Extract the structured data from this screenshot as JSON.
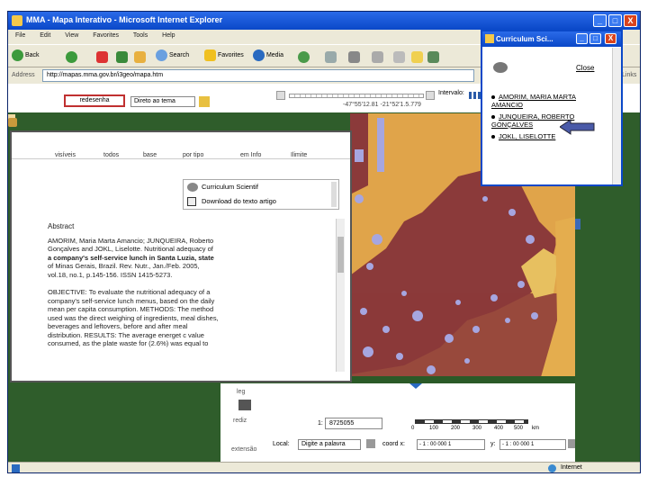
{
  "window": {
    "title": "MMA - Mapa Interativo - Microsoft Internet Explorer",
    "buttons": [
      "_",
      "□",
      "X"
    ]
  },
  "menu": [
    "File",
    "Edit",
    "View",
    "Favorites",
    "Tools",
    "Help"
  ],
  "toolbar": {
    "back": "Back",
    "search": "Search",
    "favorites": "Favorites",
    "media": "Media"
  },
  "address": {
    "label": "Address",
    "url": "http://mapas.mma.gov.br/i3geo/mapa.htm",
    "links": "Links"
  },
  "map_controls": {
    "redesenha": "redesenha",
    "layer_select": "Direto ao tema",
    "interval_label": "Intervalo:",
    "coords": "-47°55'12.81  -21°52'1.5.779",
    "scale_label": "1:",
    "scale_value": "8725055",
    "scale_ticks": [
      "0",
      "100",
      "200",
      "300",
      "400",
      "500"
    ],
    "unit": "km",
    "side_label_1": "leg",
    "side_label_2": "rediz",
    "side_label_3": "extensão",
    "local_label": "Local:",
    "local_input": "Digite a palavra",
    "coord_x_label": "coord x:",
    "coord_x_value": "- 1 : 00  000 1 ",
    "coord_y_label": "y:",
    "coord_y_value": "- 1 : 00  000 1 "
  },
  "left_dialog": {
    "tabs": [
      "visíveis",
      "todos",
      "base",
      "por tipo",
      "em Info",
      "Ilimite"
    ],
    "popup_items": [
      "Curriculum Scientif",
      "Download do texto artigo"
    ],
    "abstract_heading": "Abstract",
    "abstract_lines": [
      "AMORIM, Maria Marta Amancio; JUNQUEIRA, Roberto",
      "Gonçalves and JOKL, Liselotte. Nutritional adequacy of",
      "a company's self-service lunch in Santa Luzia, state",
      "of Minas Gerais, Brazil. Rev. Nutr., Jan./Feb. 2005,",
      "vol.18, no.1, p.145-156. ISSN 1415-5273."
    ],
    "objective_lines": [
      "OBJECTIVE: To evaluate the nutritional adequacy of a",
      "company's self-service lunch menus, based on the daily",
      "mean per capita consumption. METHODS: The method",
      "used was the direct weighing of ingredients, meal dishes,",
      "beverages and leftovers, before and after meal",
      "distribution. RESULTS: The average energet c value",
      "consumed, as the plate waste for (2.6%) was equal to"
    ]
  },
  "cv_popup": {
    "title": "Curriculum Sci...",
    "close": "Close",
    "authors": [
      "AMORIM, MARIA MARTA AMANCIO",
      "JUNQUEIRA, ROBERTO GONÇALVES",
      "JOKL, LISELOTTE"
    ]
  },
  "status": {
    "zone": "Internet"
  },
  "colors": {
    "map_state": "#8b3a3a",
    "map_water": "#a6a6e0",
    "map_neighbor": "#e0a44a",
    "map_dark": "#2b5a27",
    "xp_title": "#0a48c8"
  }
}
